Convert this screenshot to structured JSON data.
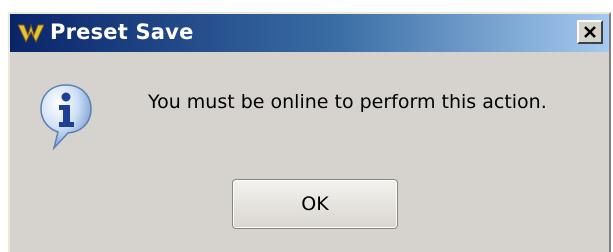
{
  "window": {
    "title": "Preset Save",
    "title_icon": "winamp-lightning-icon",
    "close_icon": "close-icon"
  },
  "dialog": {
    "icon": "info-icon",
    "message": "You must be online to perform this action.",
    "ok_label": "OK"
  },
  "colors": {
    "titlebar_start": "#0a246a",
    "titlebar_end": "#a6caf0",
    "dialog_background": "#d6d3ce"
  }
}
